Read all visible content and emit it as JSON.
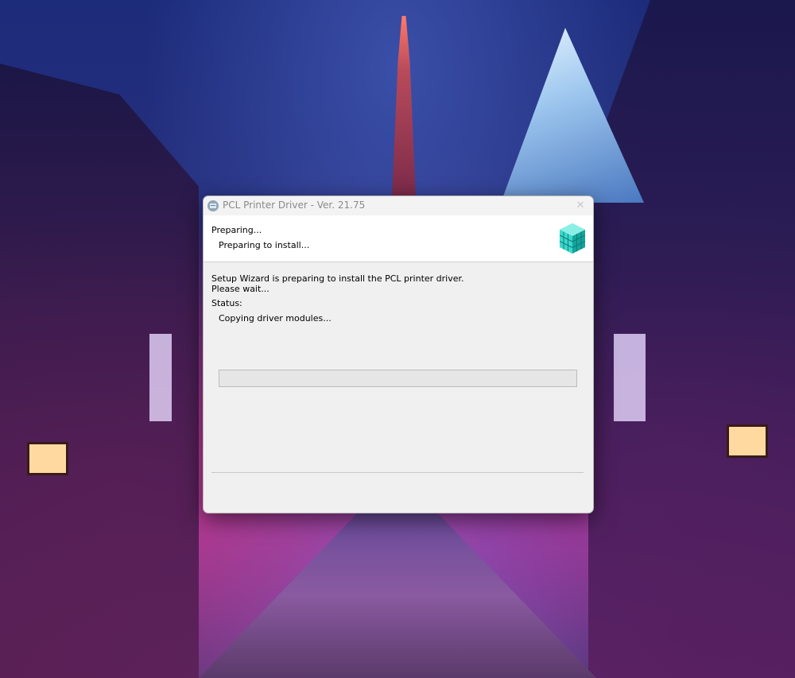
{
  "dialog": {
    "title": "PCL Printer Driver - Ver. 21.75",
    "header_title": "Preparing...",
    "header_subtitle": "Preparing to install...",
    "message_line1": "Setup Wizard is preparing to install the PCL printer driver.",
    "message_line2": "Please wait...",
    "status_label": "Status:",
    "status_value": "Copying driver modules...",
    "progress": 0,
    "close_glyph": "✕",
    "icons": {
      "app": "installer-app-icon",
      "header": "package-cubes-icon",
      "close": "close-icon"
    }
  },
  "colors": {
    "progress_fill": "#06b025",
    "header_icon_teal": "#2fd5c8"
  }
}
